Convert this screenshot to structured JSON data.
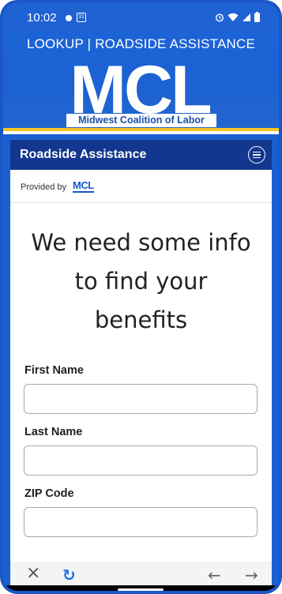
{
  "status": {
    "time": "10:02",
    "calendar_day": "31",
    "icons": [
      "notification-dot-icon",
      "calendar-icon",
      "alarm-icon",
      "wifi-icon",
      "signal-icon",
      "battery-icon"
    ]
  },
  "banner": {
    "title": "LOOKUP | ROADSIDE ASSISTANCE",
    "logo_text": "MCL",
    "logo_subtitle": "Midwest Coalition of Labor"
  },
  "nav": {
    "title": "Roadside Assistance",
    "menu_icon": "menu-icon"
  },
  "provider": {
    "label": "Provided by",
    "logo": "MCL"
  },
  "main": {
    "headline_lines": [
      "We need some info",
      "to find your",
      "benefits"
    ],
    "fields": [
      {
        "label": "First Name",
        "value": "",
        "placeholder": ""
      },
      {
        "label": "Last Name",
        "value": "",
        "placeholder": ""
      },
      {
        "label": "ZIP Code",
        "value": "",
        "placeholder": ""
      }
    ]
  },
  "browser_bar": {
    "close": "×",
    "reload": "↻",
    "back": "←",
    "forward": "→"
  },
  "colors": {
    "brand_blue": "#1a56c8",
    "nav_blue": "#13378f",
    "accent_yellow": "#f3c623"
  }
}
